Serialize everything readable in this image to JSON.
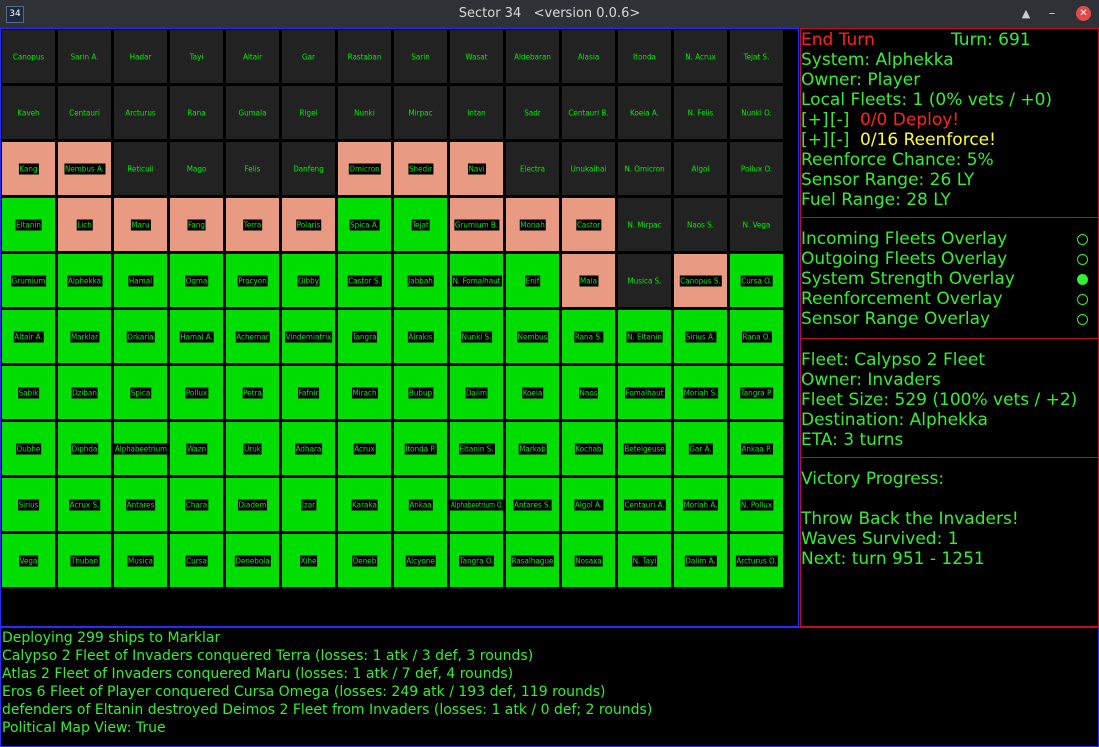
{
  "window": {
    "icon_text": "34",
    "title": "Sector 34",
    "version": "<version 0.0.6>"
  },
  "map": {
    "cols": 14,
    "rows": 10,
    "cells": [
      [
        "Canopus",
        "dark"
      ],
      [
        "Sarin A.",
        "dark"
      ],
      [
        "Hadar",
        "dark"
      ],
      [
        "Tayi",
        "dark"
      ],
      [
        "Altair",
        "dark"
      ],
      [
        "Gar",
        "dark"
      ],
      [
        "Rastaban",
        "dark"
      ],
      [
        "Sarin",
        "dark"
      ],
      [
        "Wasat",
        "dark"
      ],
      [
        "Aldebaran",
        "dark"
      ],
      [
        "Alasia",
        "dark"
      ],
      [
        "Itonda",
        "dark"
      ],
      [
        "N. Acrux",
        "dark"
      ],
      [
        "Tejat S.",
        "dark"
      ],
      [
        "Kaveh",
        "dark"
      ],
      [
        "Centauri",
        "dark"
      ],
      [
        "Arcturus",
        "dark"
      ],
      [
        "Rana",
        "dark"
      ],
      [
        "Gumala",
        "dark"
      ],
      [
        "Rigel",
        "dark"
      ],
      [
        "Nunki",
        "dark"
      ],
      [
        "Mirpac",
        "dark"
      ],
      [
        "Intan",
        "dark"
      ],
      [
        "Sadr",
        "dark"
      ],
      [
        "Centauri B.",
        "dark"
      ],
      [
        "Koeia A.",
        "dark"
      ],
      [
        "N. Felis",
        "dark"
      ],
      [
        "Nunki O.",
        "dark"
      ],
      [
        "Kang",
        "salmon"
      ],
      [
        "Nembus A.",
        "salmon"
      ],
      [
        "Reticuli",
        "dark"
      ],
      [
        "Mago",
        "dark"
      ],
      [
        "Felis",
        "dark"
      ],
      [
        "Danfeng",
        "dark"
      ],
      [
        "Omicron",
        "salmon"
      ],
      [
        "Shedir",
        "salmon"
      ],
      [
        "Navi",
        "salmon"
      ],
      [
        "Electra",
        "dark"
      ],
      [
        "Unukalhai",
        "dark"
      ],
      [
        "N. Omicron",
        "dark"
      ],
      [
        "Algol",
        "dark"
      ],
      [
        "Pollux O.",
        "dark"
      ],
      [
        "Eltanin",
        "green"
      ],
      [
        "Lich",
        "salmon"
      ],
      [
        "Maru",
        "salmon"
      ],
      [
        "Fang",
        "salmon"
      ],
      [
        "Terra",
        "salmon"
      ],
      [
        "Polaris",
        "salmon"
      ],
      [
        "Spica A.",
        "green"
      ],
      [
        "Tejat",
        "green"
      ],
      [
        "Grumium B.",
        "salmon"
      ],
      [
        "Moriah",
        "salmon"
      ],
      [
        "Castor",
        "salmon"
      ],
      [
        "N. Mirpac",
        "dark"
      ],
      [
        "Naos S.",
        "dark"
      ],
      [
        "N. Vega",
        "dark"
      ],
      [
        "Grumium",
        "green"
      ],
      [
        "Alphekka",
        "green"
      ],
      [
        "Hamal",
        "green"
      ],
      [
        "Oqma",
        "green"
      ],
      [
        "Procyon",
        "green"
      ],
      [
        "Gibby",
        "green"
      ],
      [
        "Castor S.",
        "green"
      ],
      [
        "Jabbah",
        "green"
      ],
      [
        "N. Fomalhaut",
        "green"
      ],
      [
        "Enif",
        "green"
      ],
      [
        "Maia",
        "salmon"
      ],
      [
        "Musica S.",
        "dark"
      ],
      [
        "Canopus S.",
        "salmon"
      ],
      [
        "Cursa O.",
        "green"
      ],
      [
        "Altair A.",
        "green"
      ],
      [
        "Marklar",
        "green"
      ],
      [
        "Orkaria",
        "green"
      ],
      [
        "Hamal A.",
        "green"
      ],
      [
        "Achernar",
        "green"
      ],
      [
        "Vindemiatrix",
        "green"
      ],
      [
        "Tangra",
        "green"
      ],
      [
        "Alrakis",
        "green"
      ],
      [
        "Nunki S.",
        "green"
      ],
      [
        "Nembus",
        "green"
      ],
      [
        "Rana S.",
        "green"
      ],
      [
        "N. Eltanin",
        "green"
      ],
      [
        "Sirius A.",
        "green"
      ],
      [
        "Rana O.",
        "green"
      ],
      [
        "Sabik",
        "green"
      ],
      [
        "Dziban",
        "green"
      ],
      [
        "Spica",
        "green"
      ],
      [
        "Pollux",
        "green"
      ],
      [
        "Petra",
        "green"
      ],
      [
        "Fafnir",
        "green"
      ],
      [
        "Mirach",
        "green"
      ],
      [
        "Bubup",
        "green"
      ],
      [
        "Dalim",
        "green"
      ],
      [
        "Koeia",
        "green"
      ],
      [
        "Naos",
        "green"
      ],
      [
        "Fomalhaut",
        "green"
      ],
      [
        "Moriah S.",
        "green"
      ],
      [
        "Tangra P.",
        "green"
      ],
      [
        "Dubhe",
        "green"
      ],
      [
        "Diphda",
        "green"
      ],
      [
        "Alphabeetrium",
        "green"
      ],
      [
        "Wazn",
        "green"
      ],
      [
        "Uruk",
        "green"
      ],
      [
        "Adhara",
        "green"
      ],
      [
        "Acrux",
        "green"
      ],
      [
        "Itonda P.",
        "green"
      ],
      [
        "Eltanin S.",
        "green"
      ],
      [
        "Markab",
        "green"
      ],
      [
        "Kochab",
        "green"
      ],
      [
        "Betelgeuse",
        "green"
      ],
      [
        "Gar A.",
        "green"
      ],
      [
        "Ankaa P.",
        "green"
      ],
      [
        "Sirius",
        "green"
      ],
      [
        "Acrux S.",
        "green"
      ],
      [
        "Antares",
        "green"
      ],
      [
        "Chara",
        "green"
      ],
      [
        "Diadem",
        "green"
      ],
      [
        "Izar",
        "green"
      ],
      [
        "Karaka",
        "green"
      ],
      [
        "Ankaa",
        "green"
      ],
      [
        "Alphabeetrium O.",
        "green"
      ],
      [
        "Antares S.",
        "green"
      ],
      [
        "Algol A.",
        "green"
      ],
      [
        "Centauri A.",
        "green"
      ],
      [
        "Moriah A.",
        "green"
      ],
      [
        "N. Pollux",
        "green"
      ],
      [
        "Vega",
        "green"
      ],
      [
        "Thuban",
        "green"
      ],
      [
        "Musica",
        "green"
      ],
      [
        "Cursa",
        "green"
      ],
      [
        "Denebola",
        "green"
      ],
      [
        "Xihe",
        "green"
      ],
      [
        "Deneb",
        "green"
      ],
      [
        "Alcyone",
        "green"
      ],
      [
        "Tangra O.",
        "green"
      ],
      [
        "Rasalhague",
        "green"
      ],
      [
        "Nosaxa",
        "green"
      ],
      [
        "N. Tayi",
        "green"
      ],
      [
        "Dalim A.",
        "green"
      ],
      [
        "Arcturus O.",
        "green"
      ]
    ]
  },
  "status": {
    "end_turn": "End Turn",
    "turn": "Turn: 691",
    "system": "System: Alphekka",
    "owner": "Owner: Player",
    "local_fleets": "Local Fleets: 1 (0% vets / +0)",
    "deploy_plus": "[+]",
    "deploy_minus": "[-]",
    "deploy_text": "0/0 Deploy!",
    "reinforce_plus": "[+]",
    "reinforce_minus": "[-]",
    "reinforce_text": "0/16 Reenforce!",
    "reinforce_chance": "Reenforce Chance: 5%",
    "sensor_range": "Sensor Range: 26 LY",
    "fuel_range": "Fuel Range: 28 LY"
  },
  "overlays": [
    {
      "label": "Incoming Fleets Overlay",
      "on": false
    },
    {
      "label": "Outgoing Fleets Overlay",
      "on": false
    },
    {
      "label": "System Strength Overlay",
      "on": true
    },
    {
      "label": "Reenforcement Overlay",
      "on": false
    },
    {
      "label": "Sensor Range Overlay",
      "on": false
    }
  ],
  "fleet": {
    "name": "Fleet: Calypso 2 Fleet",
    "owner": "Owner: Invaders",
    "size": "Fleet Size: 529 (100% vets / +2)",
    "destination": "Destination: Alphekka",
    "eta": "ETA: 3 turns"
  },
  "victory": {
    "heading": "Victory Progress:",
    "goal": "Throw Back the Invaders!",
    "waves": "Waves Survived: 1",
    "next": "Next: turn 951 - 1251"
  },
  "log": [
    "Deploying 299 ships to Marklar",
    "Calypso 2 Fleet of Invaders conquered Terra (losses: 1 atk / 3 def, 3 rounds)",
    "Atlas 2 Fleet of Invaders conquered Maru (losses: 1 atk / 7 def, 4 rounds)",
    "Eros 6 Fleet of Player conquered Cursa Omega (losses: 249 atk / 193 def, 119 rounds)",
    "defenders of Eltanin destroyed Deimos 2 Fleet from Invaders (losses: 1 atk / 0 def; 2 rounds)",
    "Political Map View: True"
  ],
  "colors": {
    "owned_green": "#00dd00",
    "enemy_salmon": "#e99a82",
    "neutral_dark": "#222222",
    "text_green": "#33ee33",
    "alert_red": "#ff2222",
    "alert_yellow": "#ffff33"
  }
}
